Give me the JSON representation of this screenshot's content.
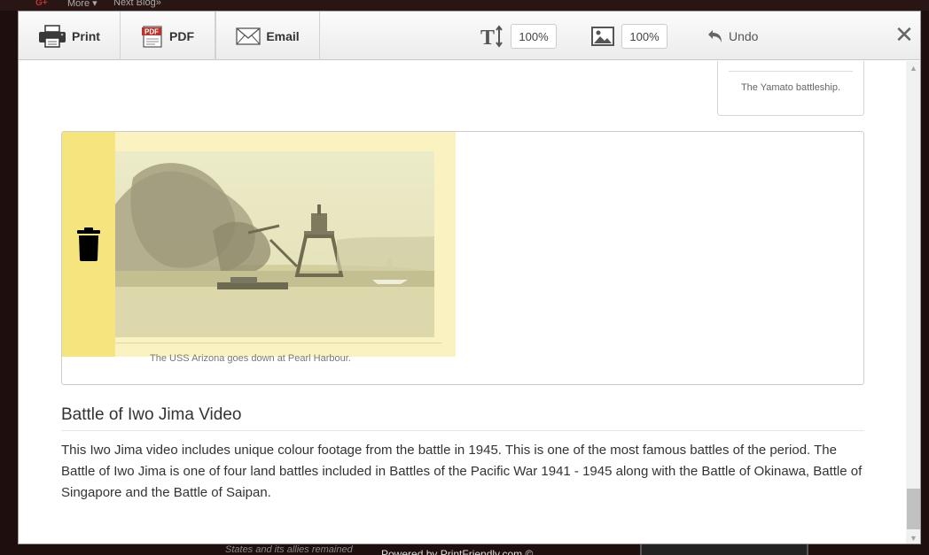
{
  "background": {
    "gplus": "G+",
    "more": "More ▾",
    "next": "Next Blog»",
    "fragment": "States and its allies remained",
    "footer": "Powered by PrintFriendly.com ©"
  },
  "toolbar": {
    "print_label": "Print",
    "pdf_label": "PDF",
    "email_label": "Email",
    "text_size": "100%",
    "image_size": "100%",
    "undo_label": "Undo",
    "close_symbol": "✕"
  },
  "content": {
    "yamato_caption": "The Yamato battleship.",
    "arizona_caption": "The USS Arizona goes down at Pearl Harbour.",
    "heading": "Battle of Iwo Jima Video",
    "paragraph": "This Iwo Jima video includes unique colour footage from the battle in 1945. This is one of the most famous battles of the period. The Battle of Iwo Jima is one of four land battles included in Battles of the Pacific War 1941 - 1945 along with the Battle of Okinawa, Battle of Singapore and the Battle of Saipan."
  },
  "icons": {
    "print": "printer-icon",
    "pdf": "pdf-icon",
    "email": "envelope-icon",
    "text": "text-size-icon",
    "image": "image-size-icon",
    "undo": "undo-icon",
    "delete": "trash-icon"
  },
  "colors": {
    "delete_highlight": "#f6e57e",
    "image_highlight": "#faf3c1"
  }
}
